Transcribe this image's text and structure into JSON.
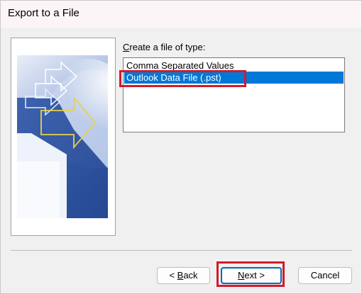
{
  "window": {
    "title": "Export to a File"
  },
  "form": {
    "prompt_accel": "C",
    "prompt_rest": "reate a file of type:",
    "file_types": [
      {
        "label": "Comma Separated Values",
        "selected": false
      },
      {
        "label": "Outlook Data File (.pst)",
        "selected": true
      }
    ]
  },
  "buttons": {
    "back": {
      "prefix": "< ",
      "accel": "B",
      "rest": "ack"
    },
    "next": {
      "accel": "N",
      "rest": "ext >"
    },
    "cancel": "Cancel"
  },
  "colors": {
    "selection": "#0078d7",
    "annotation_box": "#d11b2a",
    "default_button_border": "#0067c0"
  },
  "icons": [
    "export-wizard-illustration"
  ]
}
